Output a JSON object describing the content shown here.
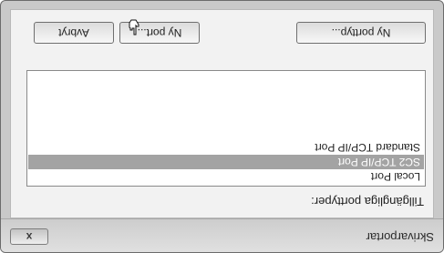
{
  "window": {
    "title": "Skrivarportar",
    "close_label": "x"
  },
  "ports": {
    "label": "Tillgängliga porttyper:",
    "items": [
      {
        "label": "Local Port",
        "selected": false
      },
      {
        "label": "SC2 TCP/IP Port",
        "selected": true
      },
      {
        "label": "Standard TCP/IP Port",
        "selected": false
      }
    ]
  },
  "buttons": {
    "new_port_type": "Ny porttyp...",
    "new_port": "Ny port...",
    "cancel": "Avbryt"
  },
  "colors": {
    "selection": "#a3a3a3",
    "window_bg": "#c9c9c9",
    "content_bg": "#f2f2f2"
  },
  "icons": {
    "cursor": "hand-pointer-icon",
    "close": "close-icon"
  }
}
